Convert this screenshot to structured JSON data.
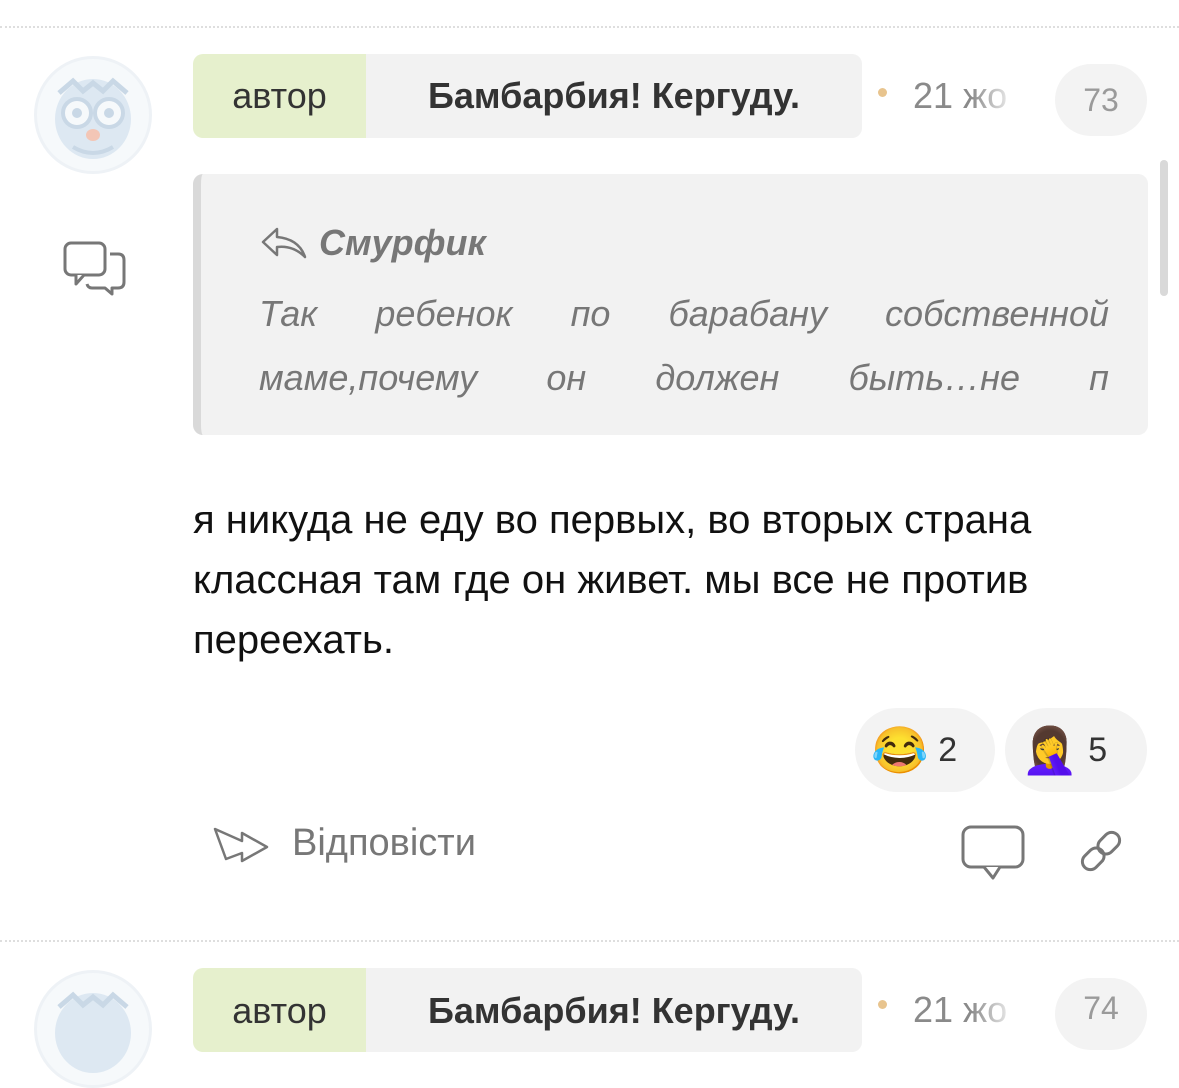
{
  "comment": {
    "author_badge": "автор",
    "author_name": "Бамбарбия! Кергуду.",
    "date": "21 жо",
    "number": "73",
    "quote": {
      "author": "Смурфик",
      "text": "Так ребенок по барабану собственной маме,почему он должен быть…не п"
    },
    "body": "я никуда не еду во первых, во вторых страна классная там где он живет. мы все не против переехать.",
    "reactions": [
      {
        "emoji": "😂",
        "icon": "tears-of-joy-emoji",
        "count": "2"
      },
      {
        "emoji": "🤦‍♀️",
        "icon": "facepalm-emoji",
        "count": "5"
      }
    ],
    "reply_label": "Відповісти"
  },
  "next_comment": {
    "author_badge": "автор",
    "author_name": "Бамбарбия! Кергуду.",
    "date": "21 жо",
    "number": "74"
  },
  "icons": [
    "owl-avatar-icon",
    "chat-bubbles-icon",
    "reply-arrow-icon",
    "comment-icon",
    "link-icon"
  ],
  "colors": {
    "author_badge_bg": "#e6f0cd",
    "name_badge_bg": "#f2f2f2",
    "quote_bg": "#f2f2f2",
    "date_dot": "#e8c48e",
    "muted_text": "#777777"
  }
}
